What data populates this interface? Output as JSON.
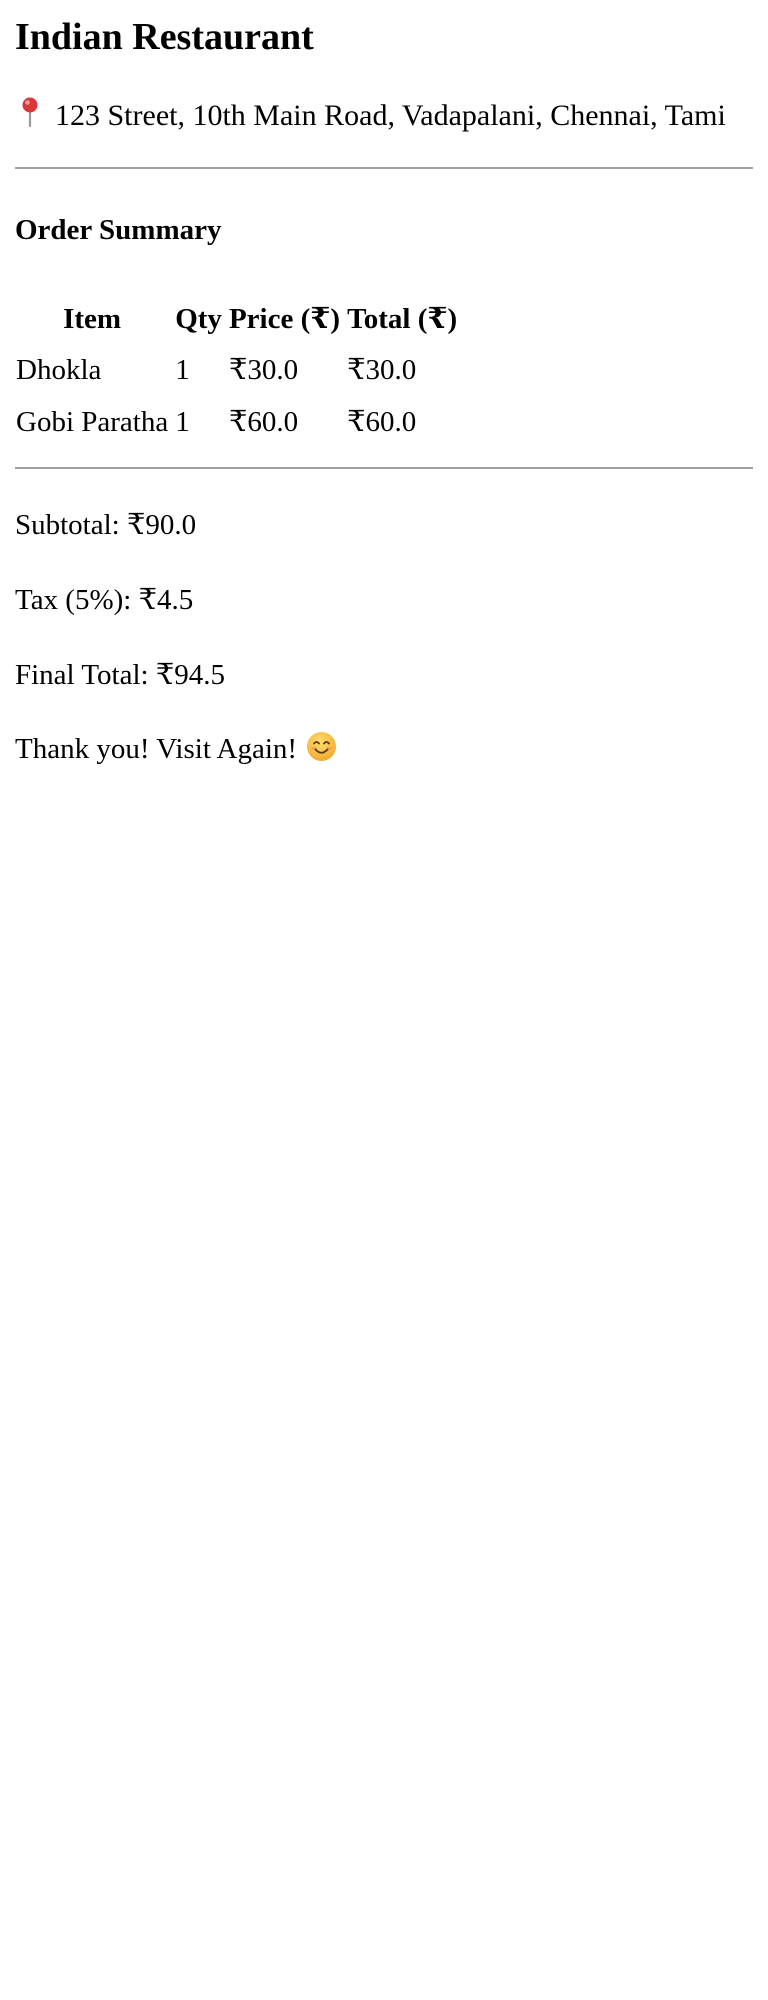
{
  "restaurant": {
    "name": "Indian Restaurant",
    "address": "123 Street, 10th Main Road, Vadapalani, Chennai, Tami",
    "address_icon": "map-pin-icon"
  },
  "order": {
    "heading": "Order Summary",
    "columns": [
      "Item",
      "Qty",
      "Price (₹)",
      "Total (₹)"
    ],
    "rows": [
      [
        "Dhokla",
        "1",
        "₹30.0",
        "₹30.0"
      ],
      [
        "Gobi Paratha",
        "1",
        "₹60.0",
        "₹60.0"
      ]
    ]
  },
  "totals": {
    "subtotal": "Subtotal: ₹90.0",
    "tax": "Tax (5%): ₹4.5",
    "final": "Final Total: ₹94.5"
  },
  "footer": {
    "message": "Thank you! Visit Again!",
    "icon": "smiling-face-icon"
  },
  "colors": {
    "text": "#000000",
    "rule": "#a0a0a0",
    "pin": "#d9383a",
    "smile": "#f5b72e"
  }
}
